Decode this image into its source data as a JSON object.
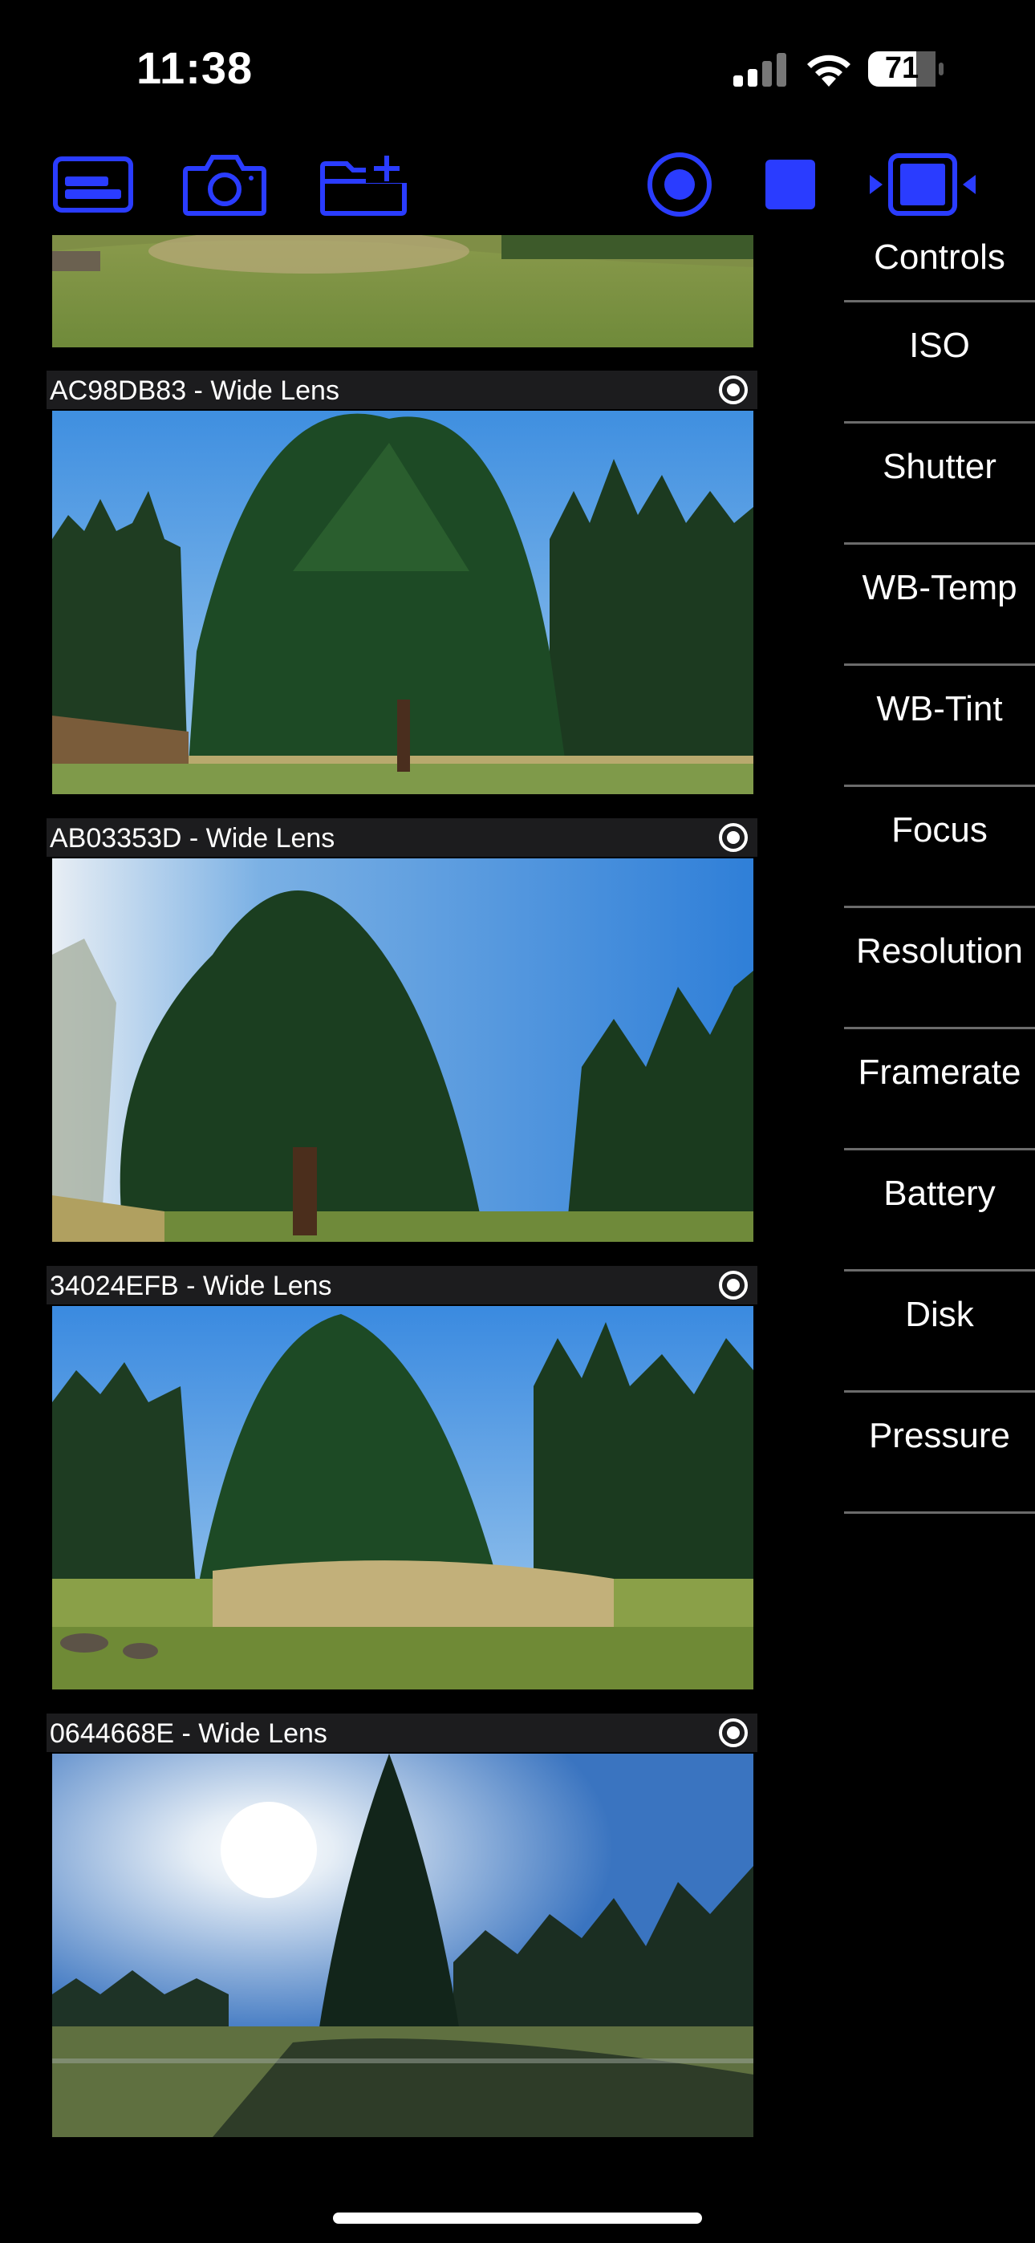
{
  "status_bar": {
    "time": "11:38",
    "battery_level": "71",
    "icons": [
      "cellular-signal-icon",
      "wifi-icon",
      "battery-icon"
    ]
  },
  "toolbar": {
    "accent_color": "#2a3cff",
    "left_icons": [
      "card-reader-icon",
      "camera-icon",
      "folder-add-icon"
    ],
    "right_icons": [
      "record-icon",
      "stop-icon",
      "device-video-icon"
    ]
  },
  "cameras": [
    {
      "label": "AC98DB83 - Wide Lens",
      "selected": false
    },
    {
      "label": "AB03353D - Wide Lens",
      "selected": false
    },
    {
      "label": "34024EFB - Wide Lens",
      "selected": false
    },
    {
      "label": "0644668E - Wide Lens",
      "selected": false
    }
  ],
  "controls": {
    "header": "Controls",
    "items": [
      "ISO",
      "Shutter",
      "WB-Temp",
      "WB-Tint",
      "Focus",
      "Resolution",
      "Framerate",
      "Battery",
      "Disk",
      "Pressure"
    ]
  }
}
